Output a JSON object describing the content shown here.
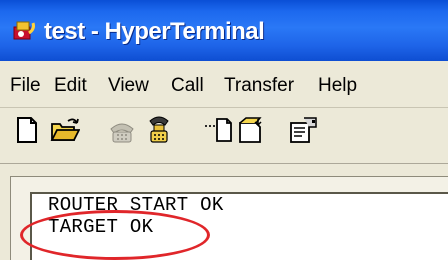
{
  "window": {
    "title": "test - HyperTerminal",
    "app_icon": "hyperterminal-icon"
  },
  "menu": {
    "items": [
      "File",
      "Edit",
      "View",
      "Call",
      "Transfer",
      "Help"
    ]
  },
  "toolbar": {
    "buttons": [
      {
        "name": "new-connection-icon"
      },
      {
        "name": "open-icon"
      },
      {
        "name": "connect-phone-icon"
      },
      {
        "name": "disconnect-icon"
      },
      {
        "name": "send-file-icon"
      },
      {
        "name": "receive-file-icon"
      },
      {
        "name": "properties-icon"
      }
    ]
  },
  "terminal": {
    "lines": [
      "ROUTER START OK",
      "TARGET OK"
    ]
  },
  "annotation": {
    "color": "#e0262a",
    "target": "TARGET OK"
  }
}
